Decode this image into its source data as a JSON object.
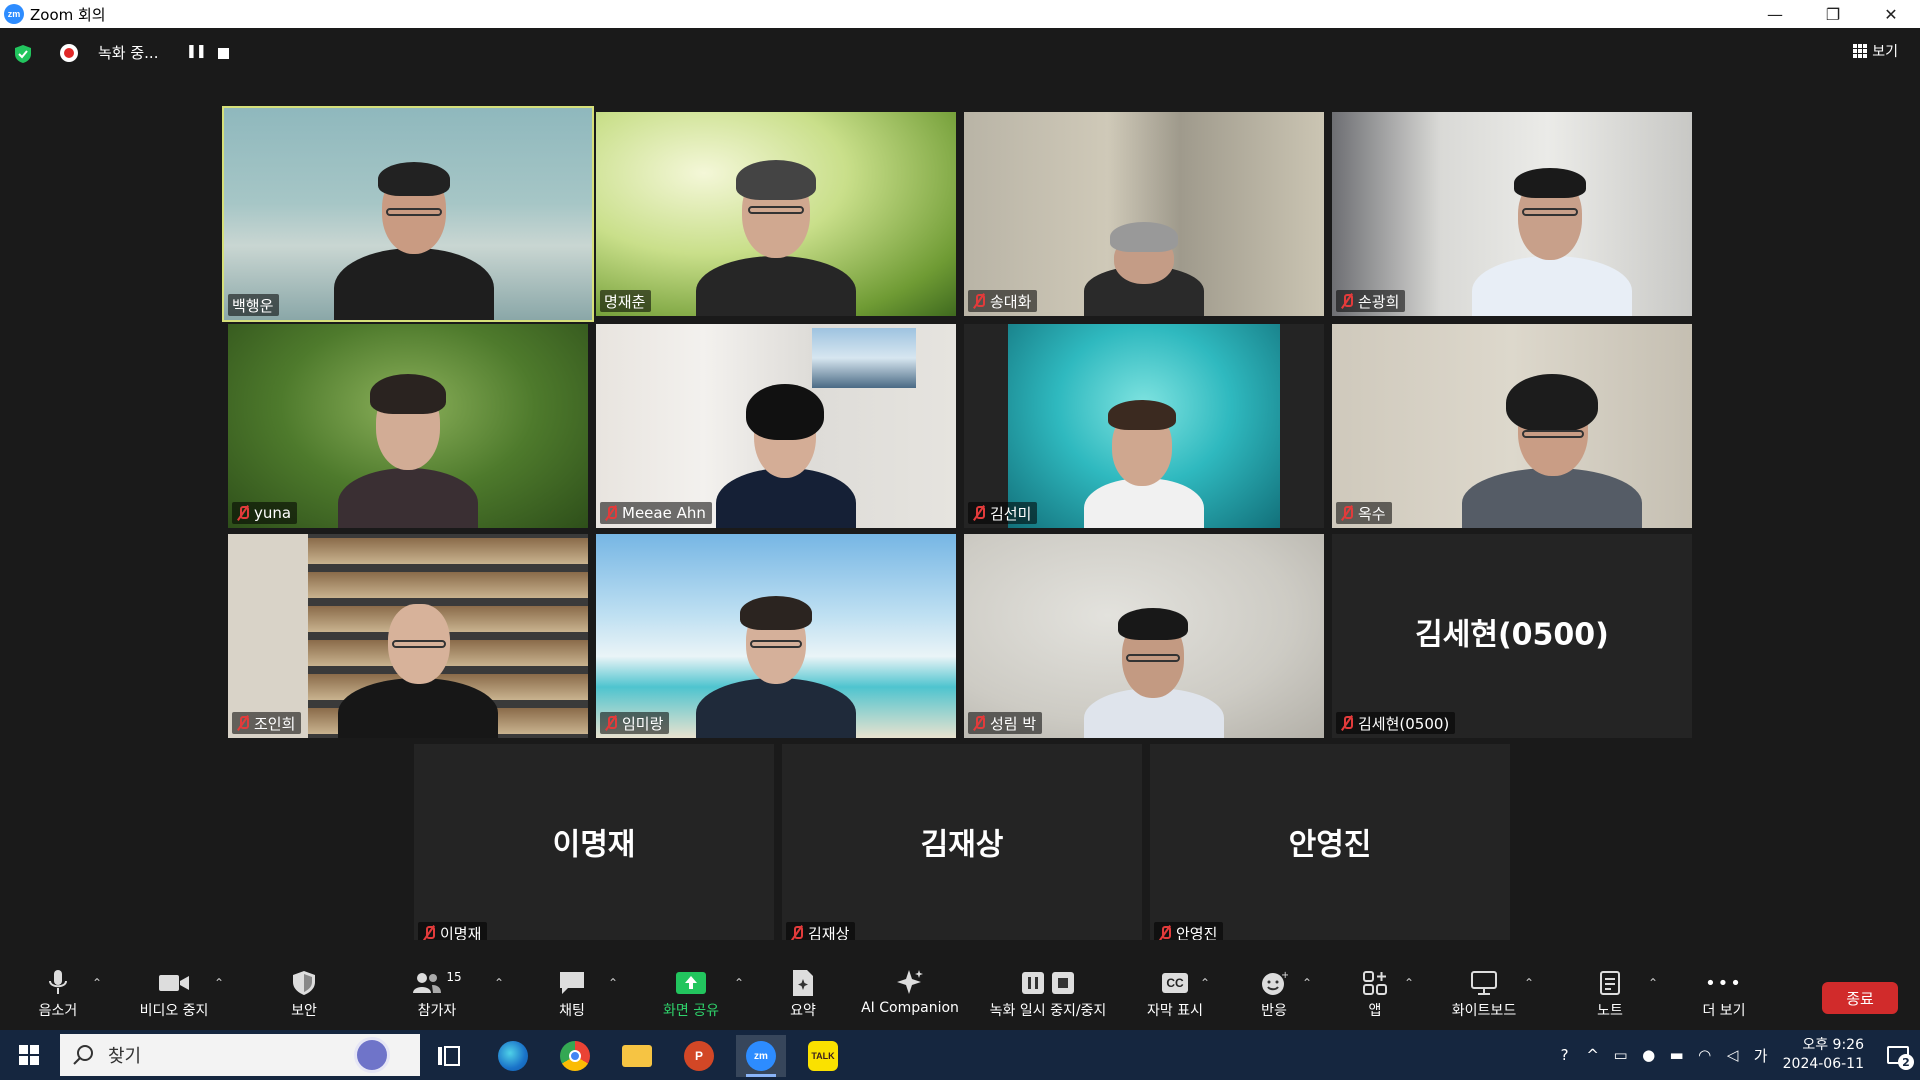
{
  "window": {
    "app_icon_text": "zm",
    "title": "Zoom 회의",
    "minimize": "—",
    "restore": "❐",
    "close": "✕"
  },
  "recording": {
    "status": "녹화 중...",
    "pause_icon": "❚❚"
  },
  "view_button": {
    "label": "보기"
  },
  "participants": [
    {
      "name": "백행운",
      "muted": false,
      "active_speaker": true
    },
    {
      "name": "명재춘",
      "muted": false
    },
    {
      "name": "송대화",
      "muted": true
    },
    {
      "name": "손광희",
      "muted": true
    },
    {
      "name": "yuna",
      "muted": true
    },
    {
      "name": "Meeae Ahn",
      "muted": true
    },
    {
      "name": "김선미",
      "muted": true
    },
    {
      "name": "옥수",
      "muted": true
    },
    {
      "name": "조인희",
      "muted": true
    },
    {
      "name": "임미랑",
      "muted": true
    },
    {
      "name": "성림 박",
      "muted": true
    },
    {
      "name": "김세현(0500)",
      "muted": true,
      "video_off": true,
      "big_name": "김세현(0500)"
    },
    {
      "name": "이명재",
      "muted": true,
      "video_off": true,
      "big_name": "이명재"
    },
    {
      "name": "김재상",
      "muted": true,
      "video_off": true,
      "big_name": "김재상"
    },
    {
      "name": "안영진",
      "muted": true,
      "video_off": true,
      "big_name": "안영진"
    }
  ],
  "toolbar": {
    "mute": "음소거",
    "stop_video": "비디오 중지",
    "security": "보안",
    "participants": "참가자",
    "participants_count": "15",
    "chat": "채팅",
    "share_screen": "화면 공유",
    "summary": "요약",
    "ai_companion": "AI Companion",
    "pause_stop_recording": "녹화 일시 중지/중지",
    "captions": "자막 표시",
    "captions_icon": "CC",
    "reactions": "반응",
    "apps": "앱",
    "whiteboard": "화이트보드",
    "notes": "노트",
    "more": "더 보기",
    "more_icon": "•••",
    "end": "종료",
    "caret": "⌃"
  },
  "taskbar": {
    "search_label": "찾기",
    "ppt_letter": "P",
    "zoom_letter": "zm",
    "kakao_label": "TALK",
    "ime": "가",
    "time": "오후 9:26",
    "date": "2024-06-11",
    "notifications": "2"
  },
  "colors": {
    "meeting_bg": "#1a1a1a",
    "active_speaker_border": "#d6e07a",
    "share_green": "#22c55e",
    "end_red": "#d12b2b",
    "taskbar": "#15263f"
  }
}
